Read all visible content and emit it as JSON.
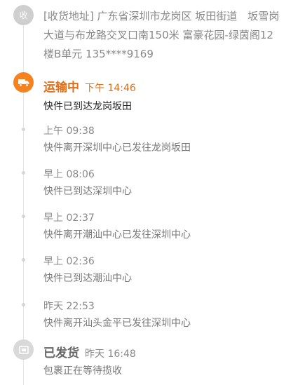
{
  "address": {
    "node_label": "收",
    "lines": [
      "[收货地址] 广东省深圳市龙岗区 坂田街道　坂雪岗",
      "大道与布龙路交叉口南150米 富豪花园-绿茵阁12",
      "楼B单元 135****9169"
    ]
  },
  "current": {
    "status": "运输中",
    "time": "下午 14:46",
    "desc": "快件已到达龙岗坂田",
    "icon": "truck-icon",
    "color": "#f5811f"
  },
  "events": [
    {
      "time": "上午 09:38",
      "desc": "快件离开深圳中心已发往龙岗坂田"
    },
    {
      "time": "早上 08:06",
      "desc": "快件已到达深圳中心"
    },
    {
      "time": "早上 02:37",
      "desc": "快件离开潮汕中心已发往深圳中心"
    },
    {
      "time": "早上 02:36",
      "desc": "快件已到达潮汕中心"
    },
    {
      "time": "昨天 22:53",
      "desc": "快件离开汕头金平已发往深圳中心"
    }
  ],
  "shipped": {
    "status": "已发货",
    "time": "昨天 16:48",
    "desc": "包裹正在等待揽收",
    "icon": "package-icon"
  }
}
